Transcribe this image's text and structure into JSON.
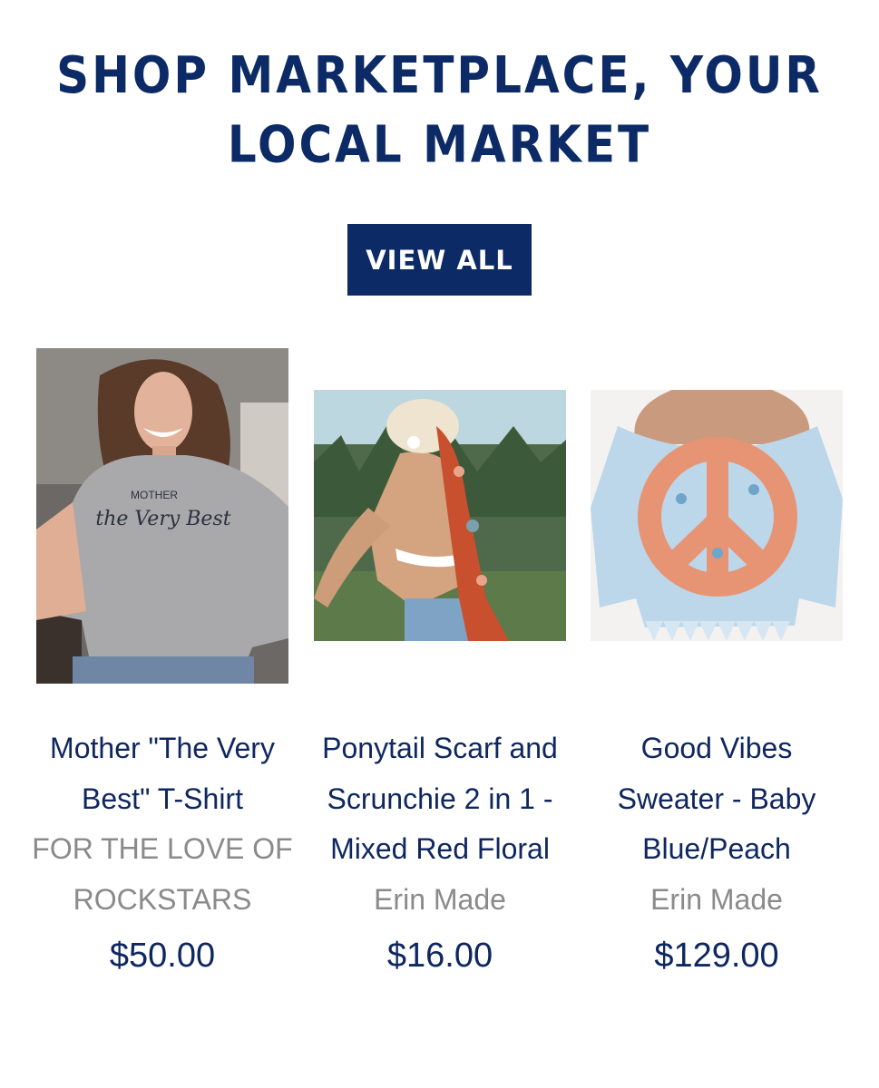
{
  "section": {
    "heading": "SHOP MARKETPLACE, YOUR LOCAL MARKET",
    "view_all_label": "VIEW ALL"
  },
  "products": [
    {
      "title": "Mother \"The Very Best\" T-Shirt",
      "vendor": "FOR THE LOVE OF ROCKSTARS",
      "price": "$50.00",
      "image": "woman-gray-tshirt-photo",
      "image_text": {
        "line1": "MOTHER",
        "line2": "the Very Best"
      }
    },
    {
      "title": "Ponytail Scarf and Scrunchie 2 in 1 - Mixed Red Floral",
      "vendor": "Erin Made",
      "price": "$16.00",
      "image": "woman-red-floral-scarf-photo"
    },
    {
      "title": "Good Vibes Sweater - Baby Blue/Peach",
      "vendor": "Erin Made",
      "price": "$129.00",
      "image": "baby-blue-peace-sign-sweater-photo"
    }
  ],
  "colors": {
    "navy": "#0c2a66",
    "vendor_gray": "#8a8a8a",
    "background": "#ffffff"
  }
}
